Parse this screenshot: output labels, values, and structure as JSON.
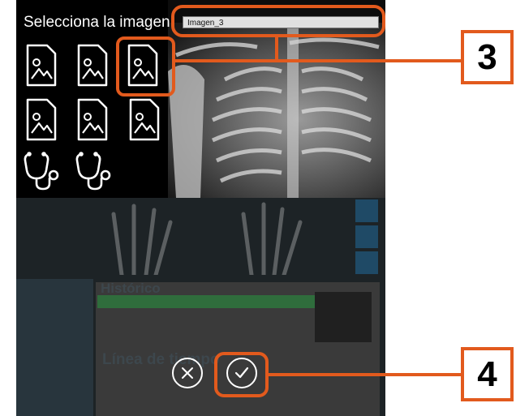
{
  "dialog": {
    "title": "Selecciona la imagen",
    "filename_value": "Imagen_3"
  },
  "thumbnails": [
    {
      "icon": "image-file-icon"
    },
    {
      "icon": "image-file-icon"
    },
    {
      "icon": "image-file-icon",
      "selected": true
    },
    {
      "icon": "image-file-icon"
    },
    {
      "icon": "image-file-icon"
    },
    {
      "icon": "image-file-icon"
    },
    {
      "icon": "stethoscope-icon"
    },
    {
      "icon": "stethoscope-icon"
    }
  ],
  "actions": {
    "cancel_icon": "close-icon",
    "confirm_icon": "check-icon"
  },
  "background_app": {
    "section_title": "Histórico",
    "timeline_title": "Línea de tiempo"
  },
  "annotations": {
    "step_3": "3",
    "step_4": "4"
  },
  "colors": {
    "annotation": "#e25a1d",
    "panel_bg": "#000000",
    "icon_stroke": "#ffffff"
  }
}
